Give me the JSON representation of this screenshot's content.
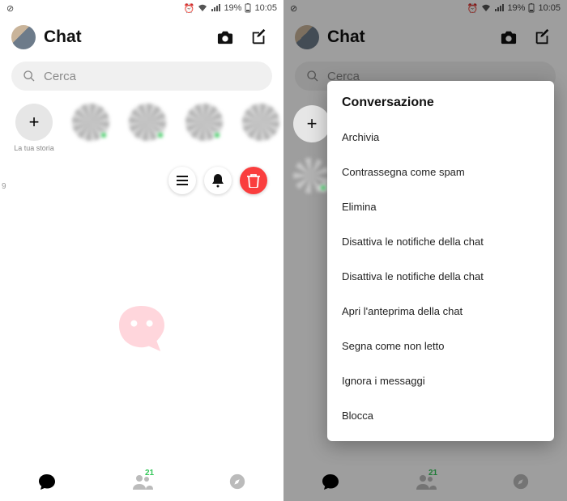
{
  "status": {
    "battery": "19%",
    "time": "10:05"
  },
  "header": {
    "title": "Chat"
  },
  "search": {
    "placeholder": "Cerca"
  },
  "stories": {
    "your_story_label": "La tua storia"
  },
  "bottom": {
    "people_badge": "21"
  },
  "stray_text": "9",
  "sheet": {
    "title": "Conversazione",
    "items": [
      "Archivia",
      "Contrassegna come spam",
      "Elimina",
      "Disattiva le notifiche della chat",
      "Disattiva le notifiche della chat",
      "Apri l'anteprima della chat",
      "Segna come non letto",
      "Ignora i messaggi",
      "Blocca"
    ]
  }
}
